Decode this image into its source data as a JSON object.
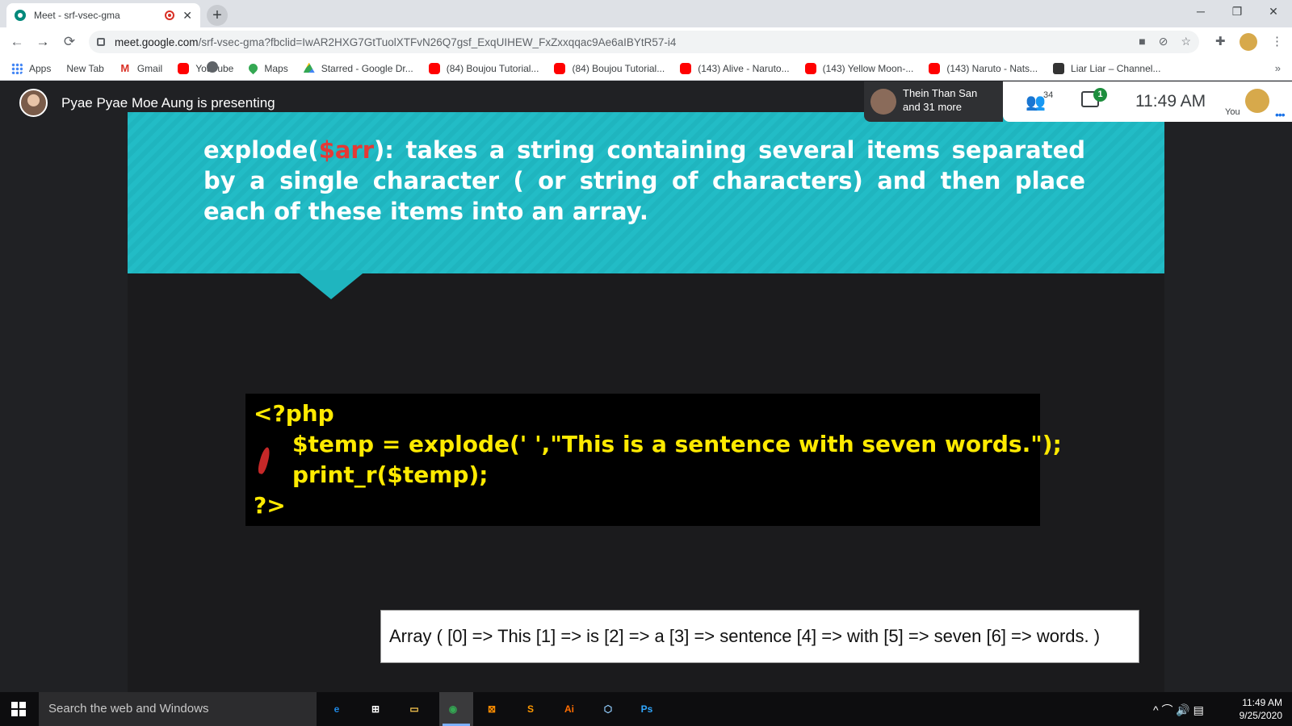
{
  "browser": {
    "tab_title": "Meet - srf-vsec-gma",
    "tab_close": "✕",
    "new_tab": "+",
    "window_controls": [
      "─",
      "❐",
      "✕"
    ],
    "url_host": "meet.google.com",
    "url_path": "/srf-vsec-gma?fbclid=IwAR2HXG7GtTuolXTFvN26Q7gsf_ExqUIHEW_FxZxxqqac9Ae6aIBYtR57-i4",
    "nav": {
      "back": "←",
      "forward": "→",
      "reload": "⟳"
    },
    "omni_icons": [
      "■",
      "⊘",
      "☆"
    ],
    "extension_icon": "✚",
    "menu_icon": "⋮"
  },
  "bookmarks": {
    "items": [
      {
        "label": "Apps",
        "icon": "apps-icon"
      },
      {
        "label": "New Tab",
        "icon": "globe-icon"
      },
      {
        "label": "Gmail",
        "icon": "gmail-icon"
      },
      {
        "label": "YouTube",
        "icon": "youtube-icon"
      },
      {
        "label": "Maps",
        "icon": "maps-icon"
      },
      {
        "label": "Starred - Google Dr...",
        "icon": "drive-icon"
      },
      {
        "label": "(84) Boujou Tutorial...",
        "icon": "youtube-icon"
      },
      {
        "label": "(84) Boujou Tutorial...",
        "icon": "youtube-icon"
      },
      {
        "label": "(143) Alive - Naruto...",
        "icon": "youtube-icon"
      },
      {
        "label": "(143) Yellow Moon-...",
        "icon": "youtube-icon"
      },
      {
        "label": "(143) Naruto - Nats...",
        "icon": "youtube-icon"
      },
      {
        "label": "Liar Liar – Channel...",
        "icon": "channel-icon"
      }
    ],
    "more": "»"
  },
  "meet": {
    "presenter_text": "Pyae Pyae Moe Aung is presenting",
    "participant_name": "Thein Than San",
    "participant_more": "and 31 more",
    "people_count": "34",
    "people_icon": "👥",
    "chat_badge": "1",
    "clock": "11:49 AM",
    "you_label": "You",
    "more_dots": "•••"
  },
  "slide": {
    "text_before": "explode(",
    "text_highlight": "$arr",
    "text_after": "): takes a string containing several items separated by a single character ( or string of characters) and then place each of these items into an array.",
    "code_lines": [
      "<?php",
      "$temp = explode(' ',\"This is a sentence with seven words.\");",
      "print_r($temp);",
      "?>"
    ],
    "output": "Array ( [0] => This [1] => is [2] => a [3] => sentence [4] => with [5] => seven [6] => words. )"
  },
  "taskbar": {
    "search_placeholder": "Search the web and Windows",
    "apps": [
      {
        "label": "e",
        "color": "#1e88e5"
      },
      {
        "label": "⊞",
        "color": "#ffffff"
      },
      {
        "label": "▭",
        "color": "#f9c74f"
      },
      {
        "label": "◉",
        "color": "#34a853"
      },
      {
        "label": "⊠",
        "color": "#fb8c00"
      },
      {
        "label": "S",
        "color": "#ff9800"
      },
      {
        "label": "Ai",
        "color": "#ff6d00"
      },
      {
        "label": "⬡",
        "color": "#90caf9"
      },
      {
        "label": "Ps",
        "color": "#31a8ff"
      }
    ],
    "tray_icons": "^  ⌒  🔊  ▤",
    "time": "11:49 AM",
    "date": "9/25/2020"
  },
  "colors": {
    "slide_header": "#1fb5bf",
    "code_text": "#ffea00",
    "highlight": "#e53935",
    "chat_badge": "#1e8e3e"
  }
}
